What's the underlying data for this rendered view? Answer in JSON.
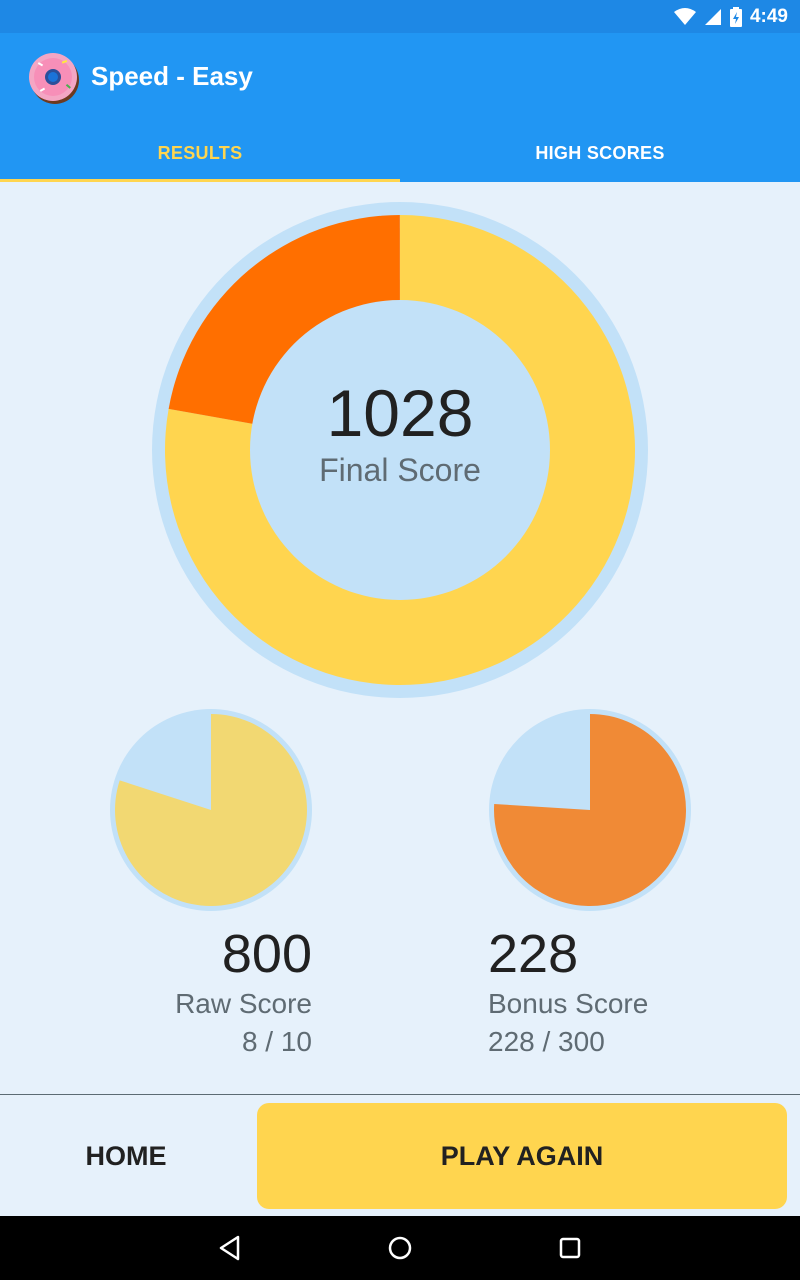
{
  "status_bar": {
    "time": "4:49"
  },
  "app_bar": {
    "title": "Speed - Easy"
  },
  "tabs": [
    {
      "label": "RESULTS",
      "selected": true
    },
    {
      "label": "HIGH SCORES",
      "selected": false
    }
  ],
  "final_score": {
    "value": "1028",
    "label": "Final Score",
    "raw_fraction_of_total": 0.778,
    "bonus_fraction_of_total": 0.222
  },
  "raw_score": {
    "value": "800",
    "label": "Raw Score",
    "detail": "8 / 10",
    "fraction": 0.8
  },
  "bonus_score": {
    "value": "228",
    "label": "Bonus Score",
    "detail": "228 / 300",
    "fraction": 0.76
  },
  "buttons": {
    "home": "HOME",
    "play_again": "PLAY AGAIN"
  },
  "colors": {
    "primary": "#2196f3",
    "status_bar": "#1e88e5",
    "accent_yellow": "#ffd54f",
    "raw_yellow": "#f2d872",
    "bonus_orange": "#f08a36",
    "final_orange": "#ff6f00",
    "ring_light": "#c2e1f8",
    "background": "#e6f1fb"
  }
}
